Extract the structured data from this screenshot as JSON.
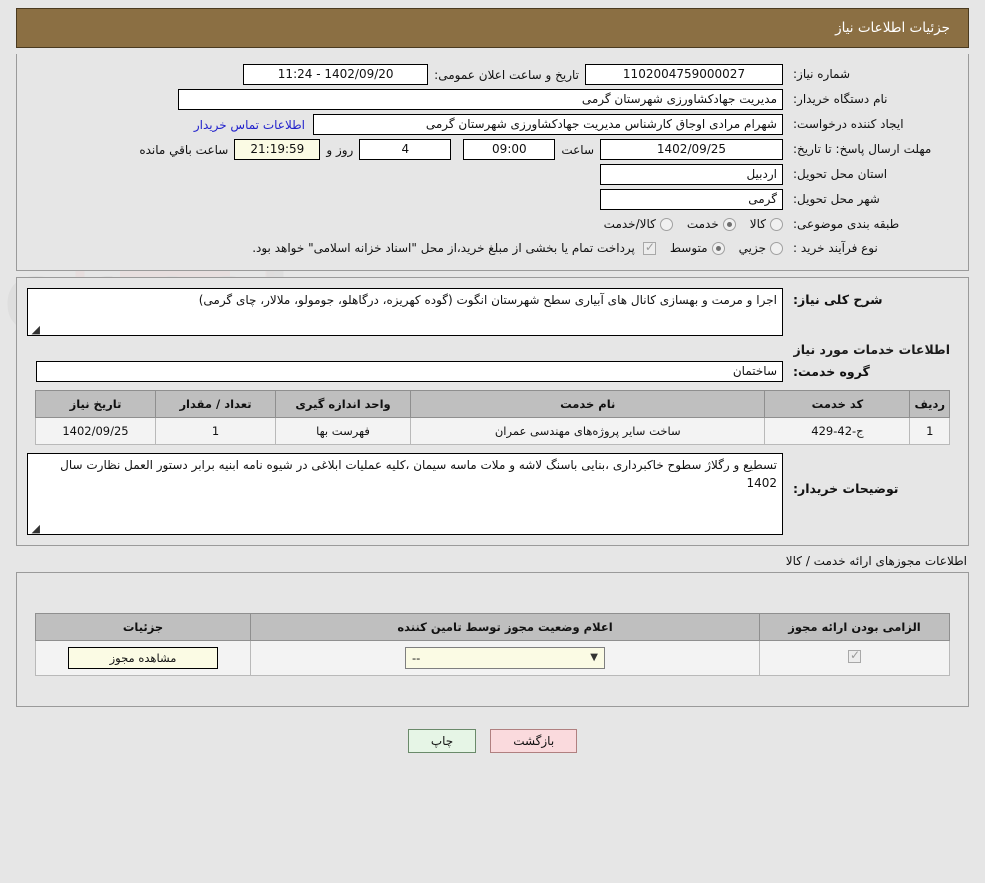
{
  "header": {
    "title": "جزئیات اطلاعات نیاز"
  },
  "form": {
    "need_number_label": "شماره نیاز:",
    "need_number_value": "1102004759000027",
    "announce_label": "تاریخ و ساعت اعلان عمومی:",
    "announce_value": "1402/09/20 - 11:24",
    "buyer_org_label": "نام دستگاه خریدار:",
    "buyer_org_value": "مدیریت جهادکشاورزی شهرستان گرمی",
    "creator_label": "ایجاد کننده درخواست:",
    "creator_value": "شهرام  مرادی اوجاق کارشناس مدیریت جهادکشاورزی شهرستان گرمی",
    "contact_link": "اطلاعات تماس خریدار",
    "deadline_label": "مهلت ارسال پاسخ: تا تاریخ:",
    "deadline_date": "1402/09/25",
    "hour_label": "ساعت",
    "hour_value": "09:00",
    "days_value": "4",
    "days_and_label": "روز و",
    "countdown_value": "21:19:59",
    "remaining_label": "ساعت باقي مانده",
    "province_label": "استان محل تحویل:",
    "province_value": "اردبیل",
    "city_label": "شهر محل تحویل:",
    "city_value": "گرمی",
    "category_label": "طبقه بندی موضوعی:",
    "category_options": [
      {
        "label": "کالا",
        "selected": false
      },
      {
        "label": "خدمت",
        "selected": true
      },
      {
        "label": "کالا/خدمت",
        "selected": false
      }
    ],
    "process_label": "نوع فرآیند خرید :",
    "process_options": [
      {
        "label": "جزیي",
        "selected": false
      },
      {
        "label": "متوسط",
        "selected": true
      }
    ],
    "payment_checkbox_checked": true,
    "payment_note": "پرداخت تمام یا بخشی از مبلغ خرید،از محل \"اسناد خزانه اسلامی\" خواهد بود."
  },
  "description": {
    "label": "شرح کلی نیاز:",
    "value": "اجرا و مرمت و بهسازی کانال های  آبیاری سطح شهرستان انگوت (گوده کهریزه، درگاهلو، جومولو، ملالار، چای گرمی)"
  },
  "services_section": {
    "heading": "اطلاعات خدمات مورد نیاز",
    "group_label": "گروه خدمت:",
    "group_value": "ساختمان",
    "table": {
      "columns": [
        "ردیف",
        "کد خدمت",
        "نام خدمت",
        "واحد اندازه گیری",
        "تعداد / مقدار",
        "تاریخ نیاز"
      ],
      "rows": [
        {
          "row": "1",
          "code": "ج-42-429",
          "name": "ساخت سایر پروژه‌های مهندسی عمران",
          "unit": "فهرست بها",
          "qty": "1",
          "date": "1402/09/25"
        }
      ]
    },
    "buyer_notes_label": "توضیحات خریدار:",
    "buyer_notes_value": "تسطیع و رگلاژ سطوح خاکبرداری ،بنایی باسنگ لاشه و ملات ماسه سیمان ،کلیه عملیات ابلاغی در شیوه نامه ابنیه  برابر دستور العمل نظارت سال 1402"
  },
  "permits": {
    "caption": "اطلاعات مجوزهای ارائه خدمت / کالا",
    "columns": [
      "الزامی بودن ارائه مجوز",
      "اعلام وضعیت مجوز توسط تامین کننده",
      "جزئیات"
    ],
    "rows": [
      {
        "required_checked": true,
        "status_value": "--",
        "detail_label": "مشاهده مجوز"
      }
    ]
  },
  "footer": {
    "print_label": "چاپ",
    "back_label": "بازگشت"
  }
}
